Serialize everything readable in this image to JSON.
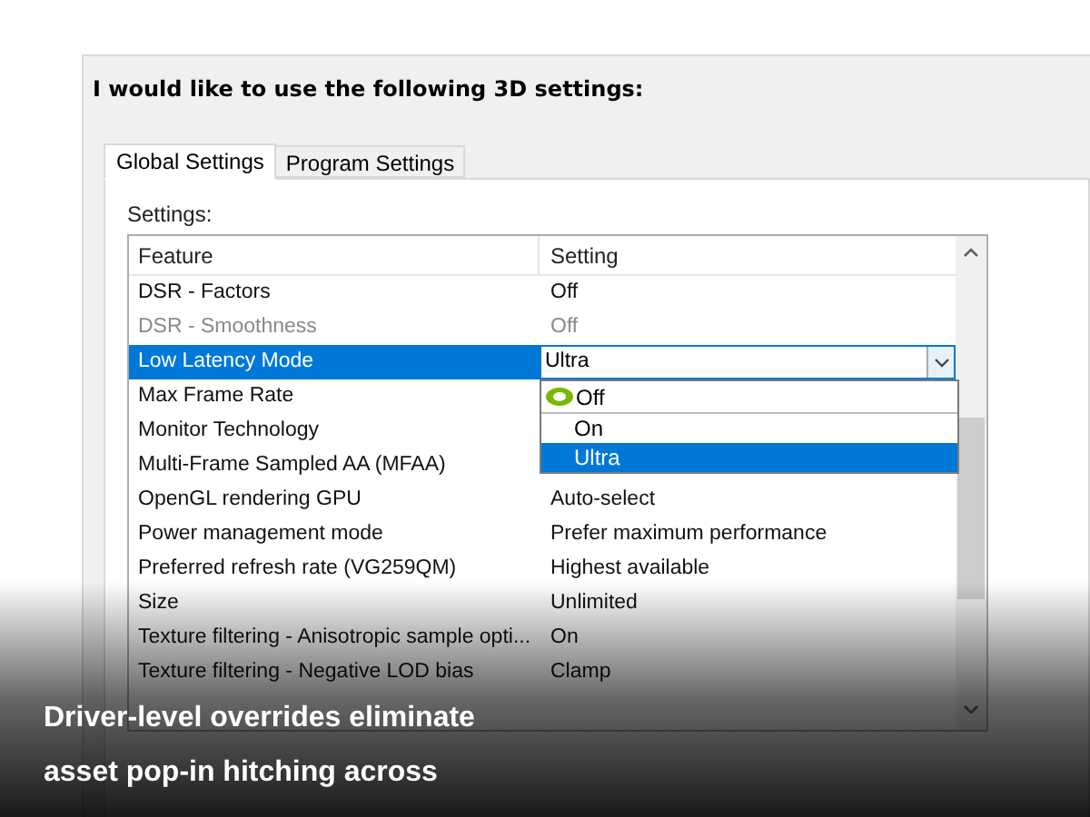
{
  "heading": "I would like to use the following 3D settings:",
  "tabs": [
    {
      "label": "Global Settings",
      "selected": true
    },
    {
      "label": "Program Settings",
      "selected": false
    }
  ],
  "settings_label": "Settings:",
  "table": {
    "columns": [
      "Feature",
      "Setting"
    ],
    "rows": [
      {
        "feature": "DSR - Factors",
        "setting": "Off",
        "disabled": false,
        "selected": false
      },
      {
        "feature": "DSR - Smoothness",
        "setting": "Off",
        "disabled": true,
        "selected": false
      },
      {
        "feature": "Low Latency Mode",
        "setting": "Ultra",
        "disabled": false,
        "selected": true
      },
      {
        "feature": "Max Frame Rate",
        "disabled": false,
        "selected": false
      },
      {
        "feature": "Monitor Technology",
        "disabled": false,
        "selected": false
      },
      {
        "feature": "Multi-Frame Sampled AA (MFAA)",
        "disabled": false,
        "selected": false
      },
      {
        "feature": "OpenGL rendering GPU",
        "setting": "Auto-select",
        "disabled": false,
        "selected": false
      },
      {
        "feature": "Power management mode",
        "setting": "Prefer maximum performance",
        "disabled": false,
        "selected": false
      },
      {
        "feature": "Preferred refresh rate (VG259QM)",
        "setting": "Highest available",
        "disabled": false,
        "selected": false
      },
      {
        "feature": "Size",
        "setting": "Unlimited",
        "disabled": false,
        "selected": false
      },
      {
        "feature": "Texture filtering - Anisotropic sample opti...",
        "setting": "On",
        "disabled": false,
        "selected": false
      },
      {
        "feature": "Texture filtering - Negative LOD bias",
        "setting": "Clamp",
        "disabled": false,
        "selected": false
      }
    ]
  },
  "dropdown": {
    "options": [
      {
        "label": "Off",
        "selected": false,
        "default": true
      },
      {
        "label": "On",
        "selected": false,
        "default": false
      },
      {
        "label": "Ultra",
        "selected": true,
        "default": false
      }
    ]
  },
  "caption": [
    "Driver-level overrides eliminate",
    "asset pop-in hitching across"
  ]
}
